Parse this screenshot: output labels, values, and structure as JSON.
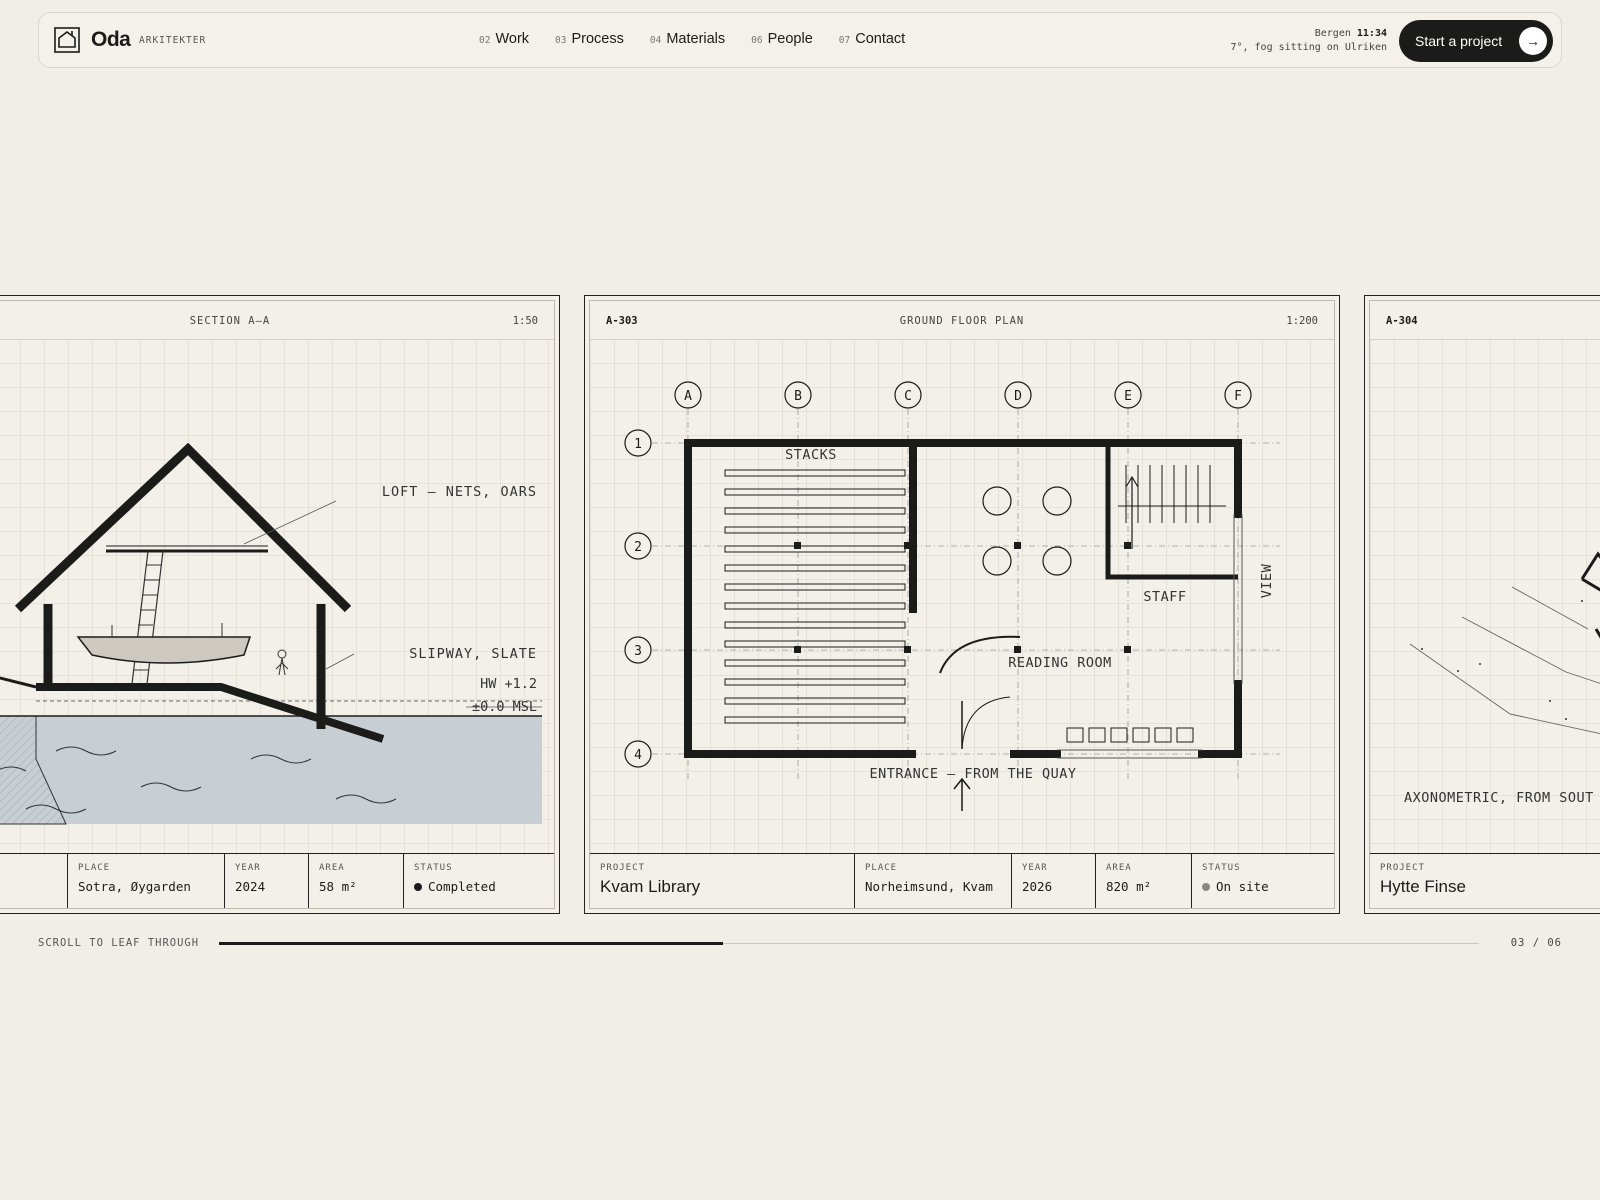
{
  "header": {
    "brand": "Oda",
    "brand_sub": "ARKITEKTER",
    "nav": [
      {
        "num": "02",
        "label": "Work"
      },
      {
        "num": "03",
        "label": "Process"
      },
      {
        "num": "04",
        "label": "Materials"
      },
      {
        "num": "06",
        "label": "People"
      },
      {
        "num": "07",
        "label": "Contact"
      }
    ],
    "weather": {
      "city": "Bergen",
      "time": "11:34",
      "condition": "7°, fog sitting on Ulriken"
    },
    "cta": "Start a project",
    "cta_icon": "arrow-right-icon"
  },
  "cards": [
    {
      "code": "",
      "title": "SECTION A–A",
      "scale": "1:50",
      "labels": {
        "loft": "LOFT — NETS, OARS",
        "slipway": "SLIPWAY, SLATE",
        "hw": "HW +1.2",
        "msl": "±0.0 MSL"
      },
      "place": "Sotra, Øygarden",
      "year": "2024",
      "area": "58 m²",
      "status": "Completed",
      "status_color": "#1b1b1a",
      "keys": {
        "place": "PLACE",
        "year": "YEAR",
        "area": "AREA",
        "status": "STATUS"
      }
    },
    {
      "code": "A-303",
      "title": "GROUND FLOOR PLAN",
      "scale": "1:200",
      "grid_cols": [
        "A",
        "B",
        "C",
        "D",
        "E",
        "F"
      ],
      "grid_rows": [
        "1",
        "2",
        "3",
        "4"
      ],
      "labels": {
        "stacks": "STACKS",
        "staff": "STAFF",
        "reading": "READING ROOM",
        "view": "VIEW",
        "entrance": "ENTRANCE — FROM THE QUAY"
      },
      "project": "Kvam Library",
      "place": "Norheimsund, Kvam",
      "year": "2026",
      "area": "820 m²",
      "status": "On site",
      "status_color": "#8a8780",
      "keys": {
        "project": "PROJECT",
        "place": "PLACE",
        "year": "YEAR",
        "area": "AREA",
        "status": "STATUS"
      }
    },
    {
      "code": "A-304",
      "labels": {
        "axo": "AXONOMETRIC, FROM SOUT"
      },
      "project": "Hytte Finse",
      "keys": {
        "project": "PROJECT"
      }
    }
  ],
  "scroller": {
    "label": "SCROLL TO LEAF THROUGH",
    "progress": 0.4,
    "counter": "03 / 06"
  }
}
